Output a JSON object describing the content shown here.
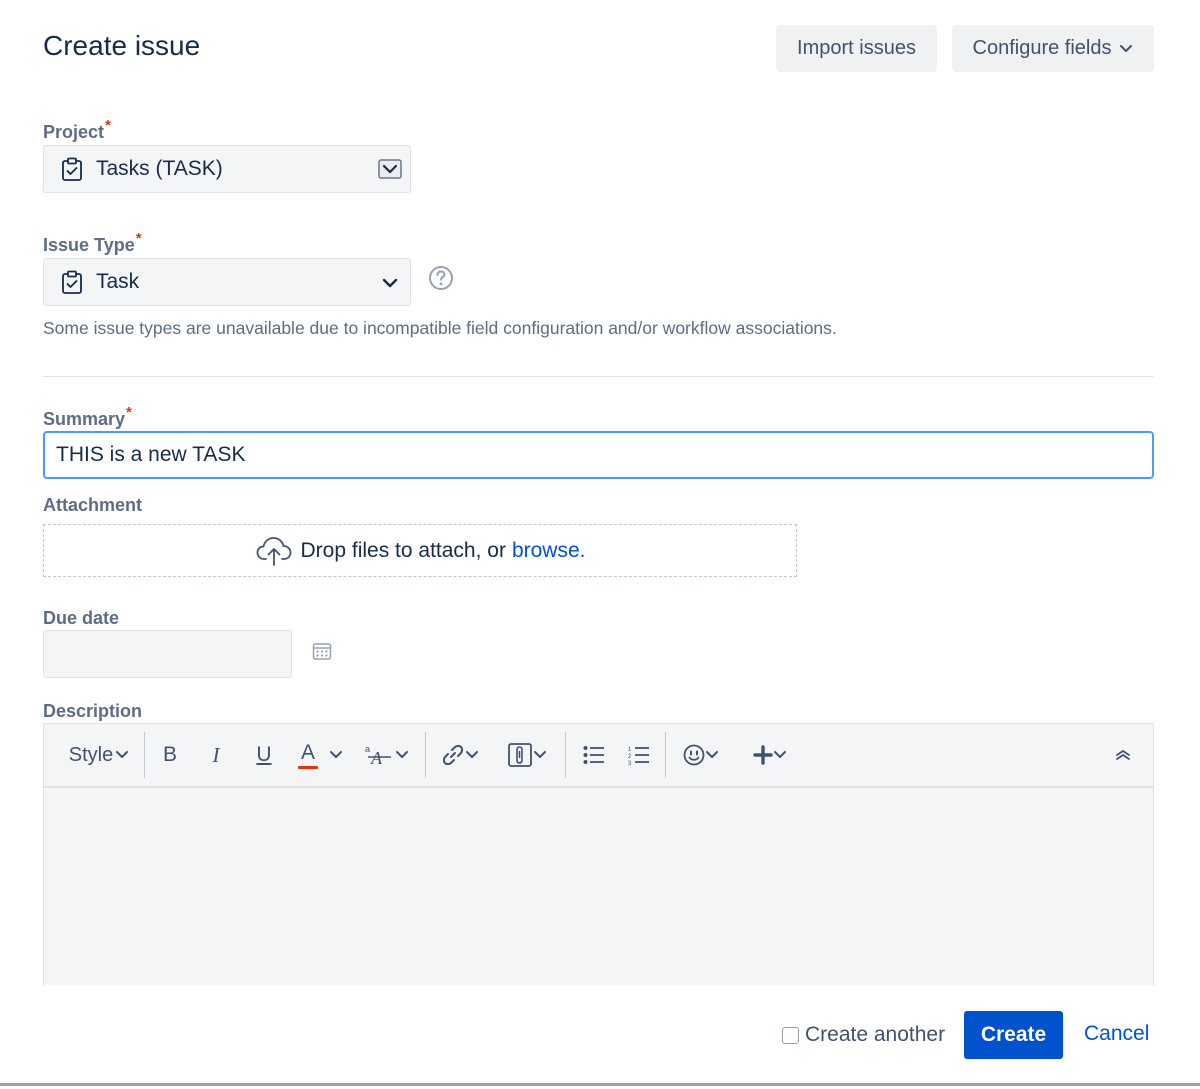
{
  "dialog": {
    "title": "Create issue"
  },
  "header": {
    "import_label": "Import issues",
    "configure_label": "Configure fields"
  },
  "project": {
    "label": "Project",
    "required_mark": "*",
    "value": "Tasks (TASK)",
    "icon": "clipboard-check-icon"
  },
  "issue_type": {
    "label": "Issue Type",
    "required_mark": "*",
    "value": "Task",
    "icon": "clipboard-check-icon",
    "help_icon": "help-icon",
    "hint": "Some issue types are unavailable due to incompatible field configuration and/or workflow associations."
  },
  "summary": {
    "label": "Summary",
    "required_mark": "*",
    "value": "THIS is a new TASK"
  },
  "attachment": {
    "label": "Attachment",
    "drop_text": "Drop files to attach, or",
    "browse_label": "browse.",
    "icon": "cloud-upload-icon"
  },
  "due_date": {
    "label": "Due date",
    "value": "",
    "icon": "calendar-icon"
  },
  "description": {
    "label": "Description",
    "toolbar": {
      "style_label": "Style",
      "bold_glyph": "B",
      "italic_glyph": "I",
      "underline_glyph": "U",
      "color_glyph": "A",
      "text_color_accent": "#de350b",
      "icons": [
        "bold-icon",
        "italic-icon",
        "underline-icon",
        "text-color-icon",
        "text-effects-icon",
        "link-icon",
        "attachment-icon",
        "bullet-list-icon",
        "numbered-list-icon",
        "emoji-icon",
        "insert-more-icon",
        "collapse-toolbar-icon"
      ]
    }
  },
  "footer": {
    "create_another_label": "Create another",
    "create_another_checked": false,
    "create_label": "Create",
    "cancel_label": "Cancel"
  },
  "colors": {
    "primary": "#0052cc",
    "focus_border": "#4c9aff",
    "required": "#de350b",
    "text": "#172b4d",
    "subtle_text": "#5e6c84"
  }
}
